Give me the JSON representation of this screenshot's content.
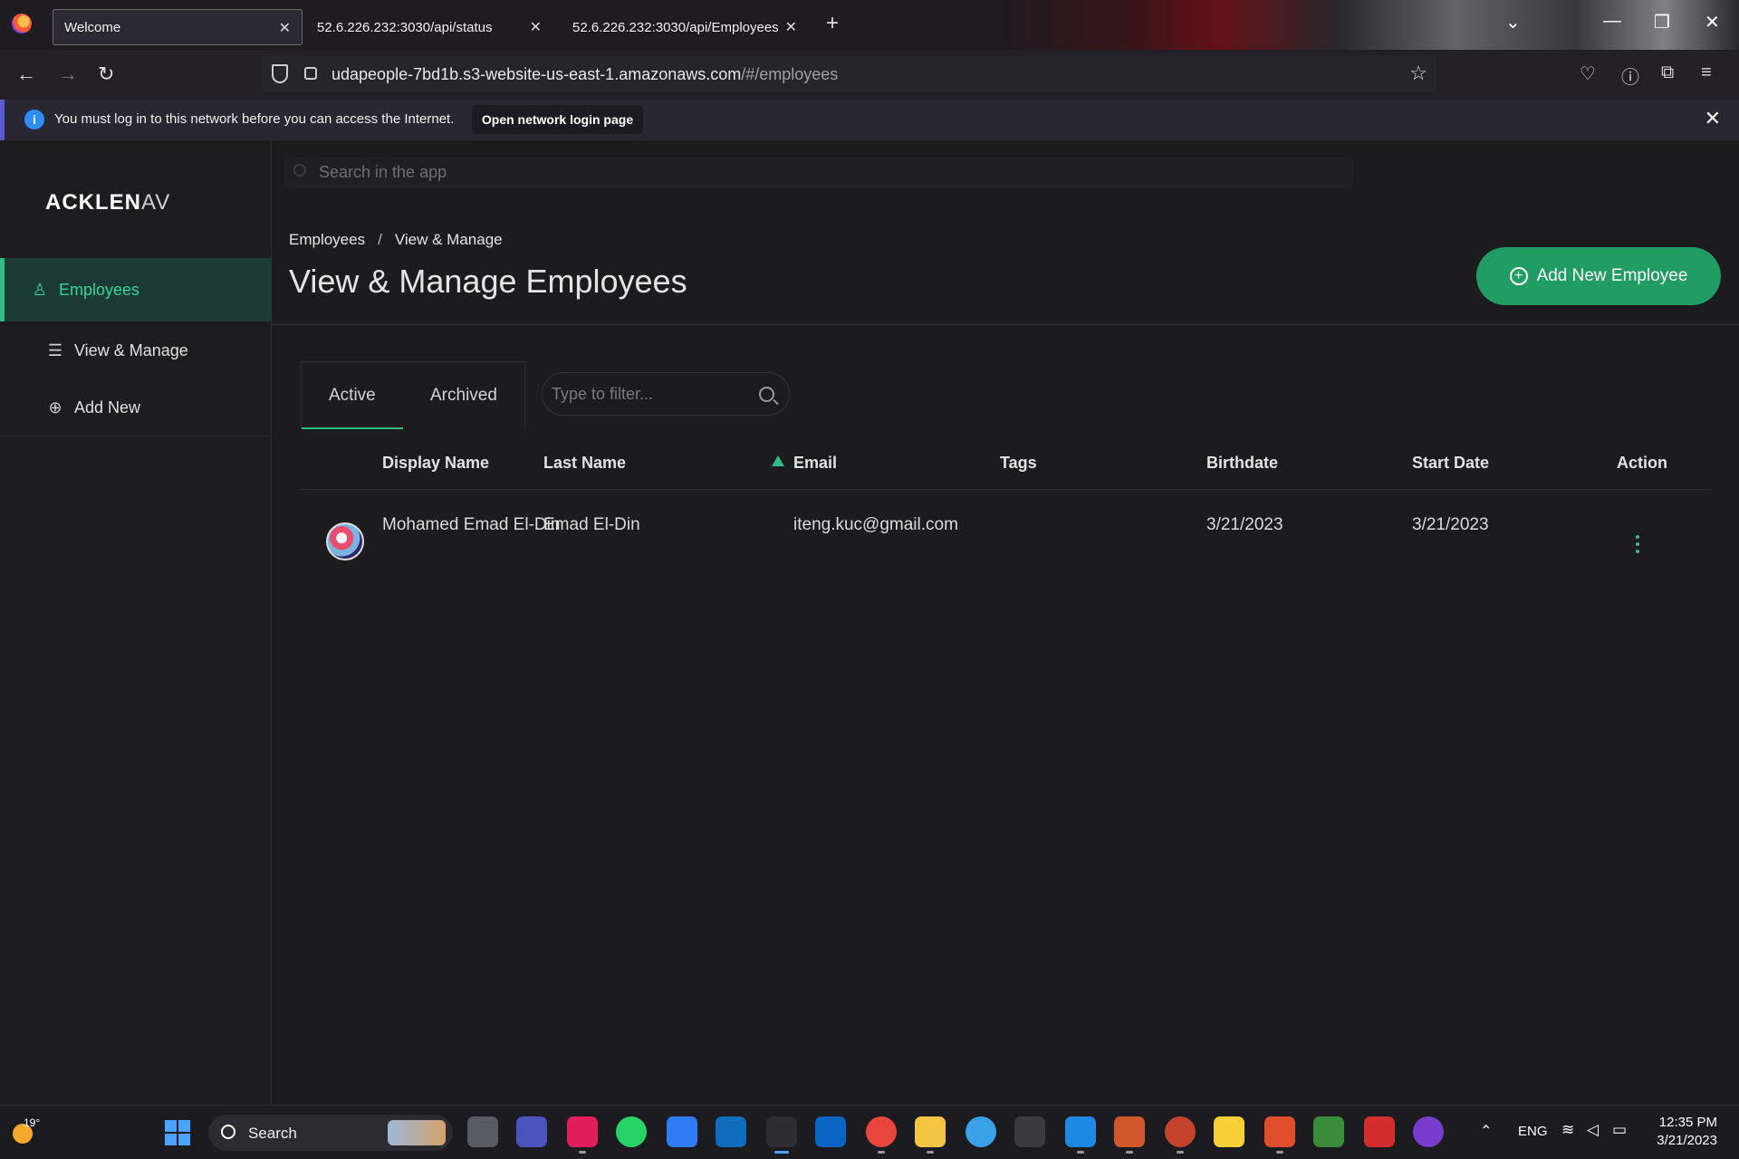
{
  "browser": {
    "tabs": [
      {
        "title": "Welcome",
        "active": true
      },
      {
        "title": "52.6.226.232:3030/api/status",
        "active": false
      },
      {
        "title": "52.6.226.232:3030/api/Employees",
        "active": false
      }
    ],
    "url_main": "udapeople-7bd1b.s3-website-us-east-1.amazonaws.com",
    "url_path": "/#/employees",
    "notice": {
      "message": "You must log in to this network before you can access the Internet.",
      "button": "Open network login page"
    }
  },
  "app": {
    "logo": {
      "bold": "ACKLEN",
      "light": "AV"
    },
    "search_placeholder": "Search in the app",
    "sidebar": {
      "items": [
        {
          "label": "Employees",
          "icon": "user-icon",
          "active": true
        },
        {
          "label": "View & Manage",
          "icon": "list-icon",
          "active": false
        },
        {
          "label": "Add New",
          "icon": "plus-circle-icon",
          "active": false
        }
      ]
    },
    "breadcrumb": [
      "Employees",
      "View & Manage"
    ],
    "page_title": "View & Manage Employees",
    "add_button": "Add New Employee",
    "filter_tabs": [
      "Active",
      "Archived"
    ],
    "filter_placeholder": "Type to filter...",
    "table": {
      "columns": [
        "Display Name",
        "Last Name",
        "Email",
        "Tags",
        "Birthdate",
        "Start Date",
        "Action"
      ],
      "sorted_column": "Email",
      "rows": [
        {
          "display_name": "Mohamed Emad El-Din",
          "last_name": "Emad El-Din",
          "email": "iteng.kuc@gmail.com",
          "tags": "",
          "birthdate": "3/21/2023",
          "start_date": "3/21/2023"
        }
      ]
    },
    "accent_color": "#2fbb86",
    "button_color": "#1f9d63"
  },
  "taskbar": {
    "weather": "19°",
    "search_label": "Search",
    "language": "ENG",
    "time": "12:35 PM",
    "date": "3/21/2023"
  }
}
